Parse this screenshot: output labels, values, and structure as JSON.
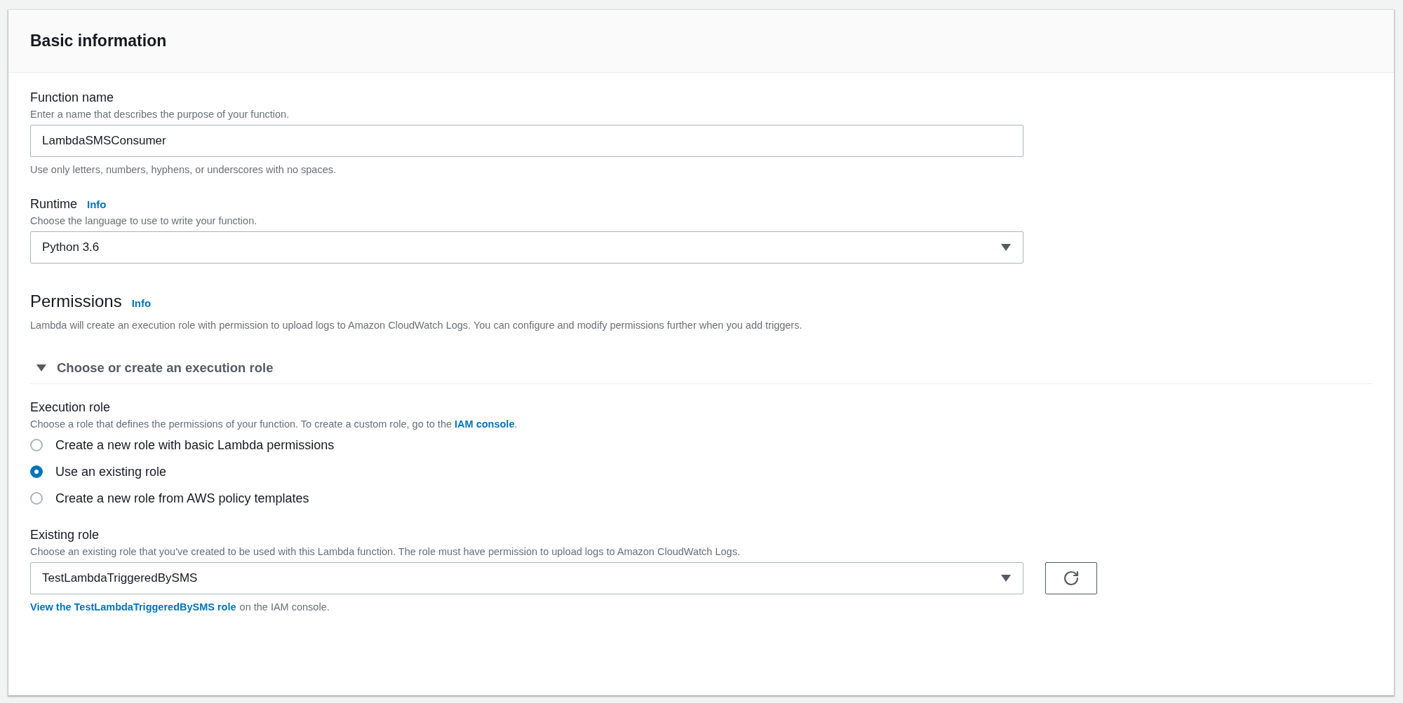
{
  "panel": {
    "title": "Basic information"
  },
  "function_name": {
    "label": "Function name",
    "hint": "Enter a name that describes the purpose of your function.",
    "value": "LambdaSMSConsumer",
    "note": "Use only letters, numbers, hyphens, or underscores with no spaces."
  },
  "runtime": {
    "label": "Runtime",
    "info": "Info",
    "hint": "Choose the language to use to write your function.",
    "value": "Python 3.6"
  },
  "permissions": {
    "title": "Permissions",
    "info": "Info",
    "description": "Lambda will create an execution role with permission to upload logs to Amazon CloudWatch Logs. You can configure and modify permissions further when you add triggers."
  },
  "role_section": {
    "title": "Choose or create an execution role",
    "expanded": true,
    "execution_role": {
      "label": "Execution role",
      "hint": "Choose a role that defines the permissions of your function. To create a custom role, go to the ",
      "hint_link": "IAM console",
      "hint_end": ".",
      "options": [
        {
          "label": "Create a new role with basic Lambda permissions",
          "selected": false
        },
        {
          "label": "Use an existing role",
          "selected": true
        },
        {
          "label": "Create a new role from AWS policy templates",
          "selected": false
        }
      ]
    },
    "existing_role": {
      "label": "Existing role",
      "hint": "Choose an existing role that you've created to be used with this Lambda function. The role must have permission to upload logs to Amazon CloudWatch Logs.",
      "value": "TestLambdaTriggeredBySMS",
      "link": "View the TestLambdaTriggeredBySMS role",
      "link_suffix": "on the IAM console."
    }
  }
}
